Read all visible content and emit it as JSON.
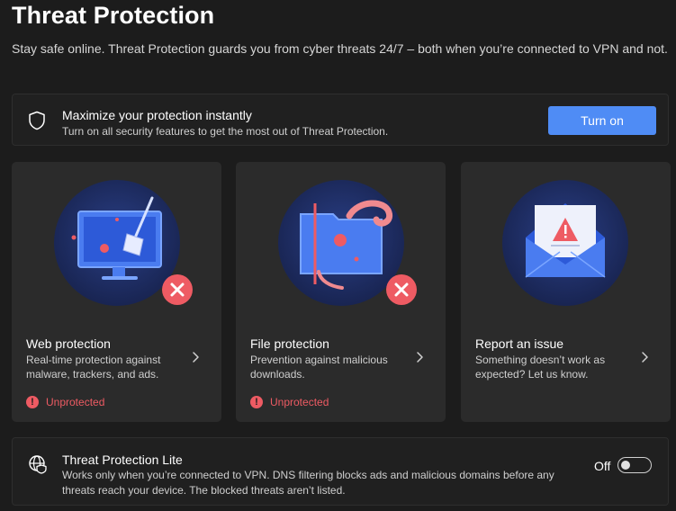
{
  "header": {
    "title": "Threat Protection",
    "subtitle": "Stay safe online. Threat Protection guards you from cyber threats 24/7 – both when you’re connected to VPN and not."
  },
  "banner": {
    "icon": "shield-icon",
    "title": "Maximize your protection instantly",
    "description": "Turn on all security features to get the most out of Threat Protection.",
    "button_label": "Turn on"
  },
  "cards": [
    {
      "title": "Web protection",
      "description": "Real-time protection against malware, trackers, and ads.",
      "status": "Unprotected",
      "illustration": "monitor-broom-icon"
    },
    {
      "title": "File protection",
      "description": "Prevention against malicious downloads.",
      "status": "Unprotected",
      "illustration": "folder-tentacle-icon"
    },
    {
      "title": "Report an issue",
      "description": "Something doesn’t work as expected? Let us know.",
      "illustration": "envelope-warning-icon"
    }
  ],
  "lite": {
    "icon": "globe-shield-icon",
    "title": "Threat Protection Lite",
    "description": "Works only when you’re connected to VPN. DNS filtering blocks ads and malicious domains before any threats reach your device. The blocked threats aren’t listed.",
    "toggle_label": "Off",
    "toggle_on": false
  },
  "colors": {
    "background": "#1c1c1c",
    "card": "#2b2b2b",
    "accent": "#4f8cf5",
    "danger": "#ee5b63"
  }
}
